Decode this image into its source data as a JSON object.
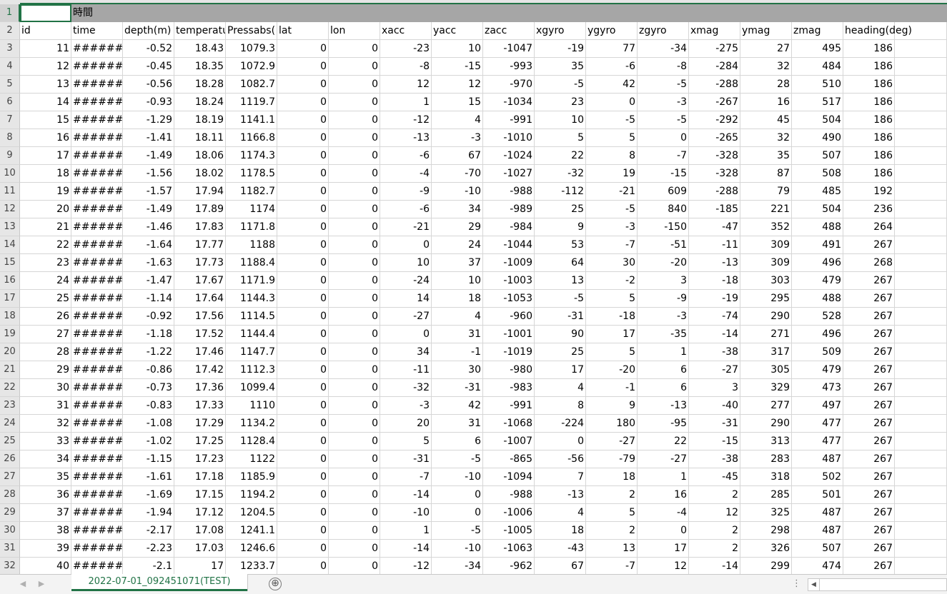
{
  "sheet": {
    "active_tab": "2022-07-01_092451071(TEST)",
    "add_sheet_glyph": "⊕",
    "nav_prev_glyph": "◀",
    "nav_next_glyph": "▶",
    "more_glyph": "⋮",
    "scroll_left_glyph": "◀"
  },
  "colors": {
    "accent": "#217346",
    "banner_fill": "#a6a6a6",
    "header_fill": "#e6e6e6"
  },
  "banner": {
    "row": "1",
    "b1": "時間"
  },
  "headers": {
    "row": "2",
    "labels": [
      "id",
      "time",
      "depth(m)",
      "temperatu",
      "Pressabs(",
      "lat",
      "lon",
      "xacc",
      "yacc",
      "zacc",
      "xgyro",
      "ygyro",
      "zgyro",
      "xmag",
      "ymag",
      "zmag",
      "heading(deg)"
    ]
  },
  "rows": [
    {
      "n": "3",
      "c": [
        "11",
        "#######",
        "-0.52",
        "18.43",
        "1079.3",
        "0",
        "0",
        "-23",
        "10",
        "-1047",
        "-19",
        "77",
        "-34",
        "-275",
        "27",
        "495",
        "186"
      ]
    },
    {
      "n": "4",
      "c": [
        "12",
        "#######",
        "-0.45",
        "18.35",
        "1072.9",
        "0",
        "0",
        "-8",
        "-15",
        "-993",
        "35",
        "-6",
        "-8",
        "-284",
        "32",
        "484",
        "186"
      ]
    },
    {
      "n": "5",
      "c": [
        "13",
        "#######",
        "-0.56",
        "18.28",
        "1082.7",
        "0",
        "0",
        "12",
        "12",
        "-970",
        "-5",
        "42",
        "-5",
        "-288",
        "28",
        "510",
        "186"
      ]
    },
    {
      "n": "6",
      "c": [
        "14",
        "#######",
        "-0.93",
        "18.24",
        "1119.7",
        "0",
        "0",
        "1",
        "15",
        "-1034",
        "23",
        "0",
        "-3",
        "-267",
        "16",
        "517",
        "186"
      ]
    },
    {
      "n": "7",
      "c": [
        "15",
        "#######",
        "-1.29",
        "18.19",
        "1141.1",
        "0",
        "0",
        "-12",
        "4",
        "-991",
        "10",
        "-5",
        "-5",
        "-292",
        "45",
        "504",
        "186"
      ]
    },
    {
      "n": "8",
      "c": [
        "16",
        "#######",
        "-1.41",
        "18.11",
        "1166.8",
        "0",
        "0",
        "-13",
        "-3",
        "-1010",
        "5",
        "5",
        "0",
        "-265",
        "32",
        "490",
        "186"
      ]
    },
    {
      "n": "9",
      "c": [
        "17",
        "#######",
        "-1.49",
        "18.06",
        "1174.3",
        "0",
        "0",
        "-6",
        "67",
        "-1024",
        "22",
        "8",
        "-7",
        "-328",
        "35",
        "507",
        "186"
      ]
    },
    {
      "n": "10",
      "c": [
        "18",
        "#######",
        "-1.56",
        "18.02",
        "1178.5",
        "0",
        "0",
        "-4",
        "-70",
        "-1027",
        "-32",
        "19",
        "-15",
        "-328",
        "87",
        "508",
        "186"
      ]
    },
    {
      "n": "11",
      "c": [
        "19",
        "#######",
        "-1.57",
        "17.94",
        "1182.7",
        "0",
        "0",
        "-9",
        "-10",
        "-988",
        "-112",
        "-21",
        "609",
        "-288",
        "79",
        "485",
        "192"
      ]
    },
    {
      "n": "12",
      "c": [
        "20",
        "#######",
        "-1.49",
        "17.89",
        "1174",
        "0",
        "0",
        "-6",
        "34",
        "-989",
        "25",
        "-5",
        "840",
        "-185",
        "221",
        "504",
        "236"
      ]
    },
    {
      "n": "13",
      "c": [
        "21",
        "#######",
        "-1.46",
        "17.83",
        "1171.8",
        "0",
        "0",
        "-21",
        "29",
        "-984",
        "9",
        "-3",
        "-150",
        "-47",
        "352",
        "488",
        "264"
      ]
    },
    {
      "n": "14",
      "c": [
        "22",
        "#######",
        "-1.64",
        "17.77",
        "1188",
        "0",
        "0",
        "0",
        "24",
        "-1044",
        "53",
        "-7",
        "-51",
        "-11",
        "309",
        "491",
        "267"
      ]
    },
    {
      "n": "15",
      "c": [
        "23",
        "#######",
        "-1.63",
        "17.73",
        "1188.4",
        "0",
        "0",
        "10",
        "37",
        "-1009",
        "64",
        "30",
        "-20",
        "-13",
        "309",
        "496",
        "268"
      ]
    },
    {
      "n": "16",
      "c": [
        "24",
        "#######",
        "-1.47",
        "17.67",
        "1171.9",
        "0",
        "0",
        "-24",
        "10",
        "-1003",
        "13",
        "-2",
        "3",
        "-18",
        "303",
        "479",
        "267"
      ]
    },
    {
      "n": "17",
      "c": [
        "25",
        "#######",
        "-1.14",
        "17.64",
        "1144.3",
        "0",
        "0",
        "14",
        "18",
        "-1053",
        "-5",
        "5",
        "-9",
        "-19",
        "295",
        "488",
        "267"
      ]
    },
    {
      "n": "18",
      "c": [
        "26",
        "#######",
        "-0.92",
        "17.56",
        "1114.5",
        "0",
        "0",
        "-27",
        "4",
        "-960",
        "-31",
        "-18",
        "-3",
        "-74",
        "290",
        "528",
        "267"
      ]
    },
    {
      "n": "19",
      "c": [
        "27",
        "#######",
        "-1.18",
        "17.52",
        "1144.4",
        "0",
        "0",
        "0",
        "31",
        "-1001",
        "90",
        "17",
        "-35",
        "-14",
        "271",
        "496",
        "267"
      ]
    },
    {
      "n": "20",
      "c": [
        "28",
        "#######",
        "-1.22",
        "17.46",
        "1147.7",
        "0",
        "0",
        "34",
        "-1",
        "-1019",
        "25",
        "5",
        "1",
        "-38",
        "317",
        "509",
        "267"
      ]
    },
    {
      "n": "21",
      "c": [
        "29",
        "#######",
        "-0.86",
        "17.42",
        "1112.3",
        "0",
        "0",
        "-11",
        "30",
        "-980",
        "17",
        "-20",
        "6",
        "-27",
        "305",
        "479",
        "267"
      ]
    },
    {
      "n": "22",
      "c": [
        "30",
        "#######",
        "-0.73",
        "17.36",
        "1099.4",
        "0",
        "0",
        "-32",
        "-31",
        "-983",
        "4",
        "-1",
        "6",
        "3",
        "329",
        "473",
        "267"
      ]
    },
    {
      "n": "23",
      "c": [
        "31",
        "#######",
        "-0.83",
        "17.33",
        "1110",
        "0",
        "0",
        "-3",
        "42",
        "-991",
        "8",
        "9",
        "-13",
        "-40",
        "277",
        "497",
        "267"
      ]
    },
    {
      "n": "24",
      "c": [
        "32",
        "#######",
        "-1.08",
        "17.29",
        "1134.2",
        "0",
        "0",
        "20",
        "31",
        "-1068",
        "-224",
        "180",
        "-95",
        "-31",
        "290",
        "477",
        "267"
      ]
    },
    {
      "n": "25",
      "c": [
        "33",
        "#######",
        "-1.02",
        "17.25",
        "1128.4",
        "0",
        "0",
        "5",
        "6",
        "-1007",
        "0",
        "-27",
        "22",
        "-15",
        "313",
        "477",
        "267"
      ]
    },
    {
      "n": "26",
      "c": [
        "34",
        "#######",
        "-1.15",
        "17.23",
        "1122",
        "0",
        "0",
        "-31",
        "-5",
        "-865",
        "-56",
        "-79",
        "-27",
        "-38",
        "283",
        "487",
        "267"
      ]
    },
    {
      "n": "27",
      "c": [
        "35",
        "#######",
        "-1.61",
        "17.18",
        "1185.9",
        "0",
        "0",
        "-7",
        "-10",
        "-1094",
        "7",
        "18",
        "1",
        "-45",
        "318",
        "502",
        "267"
      ]
    },
    {
      "n": "28",
      "c": [
        "36",
        "#######",
        "-1.69",
        "17.15",
        "1194.2",
        "0",
        "0",
        "-14",
        "0",
        "-988",
        "-13",
        "2",
        "16",
        "2",
        "285",
        "501",
        "267"
      ]
    },
    {
      "n": "29",
      "c": [
        "37",
        "#######",
        "-1.94",
        "17.12",
        "1204.5",
        "0",
        "0",
        "-10",
        "0",
        "-1006",
        "4",
        "5",
        "-4",
        "12",
        "325",
        "487",
        "267"
      ]
    },
    {
      "n": "30",
      "c": [
        "38",
        "#######",
        "-2.17",
        "17.08",
        "1241.1",
        "0",
        "0",
        "1",
        "-5",
        "-1005",
        "18",
        "2",
        "0",
        "2",
        "298",
        "487",
        "267"
      ]
    },
    {
      "n": "31",
      "c": [
        "39",
        "#######",
        "-2.23",
        "17.03",
        "1246.6",
        "0",
        "0",
        "-14",
        "-10",
        "-1063",
        "-43",
        "13",
        "17",
        "2",
        "326",
        "507",
        "267"
      ]
    },
    {
      "n": "32",
      "c": [
        "40",
        "#######",
        "-2.1",
        "17",
        "1233.7",
        "0",
        "0",
        "-12",
        "-34",
        "-962",
        "67",
        "-7",
        "12",
        "-14",
        "299",
        "474",
        "267"
      ]
    }
  ]
}
